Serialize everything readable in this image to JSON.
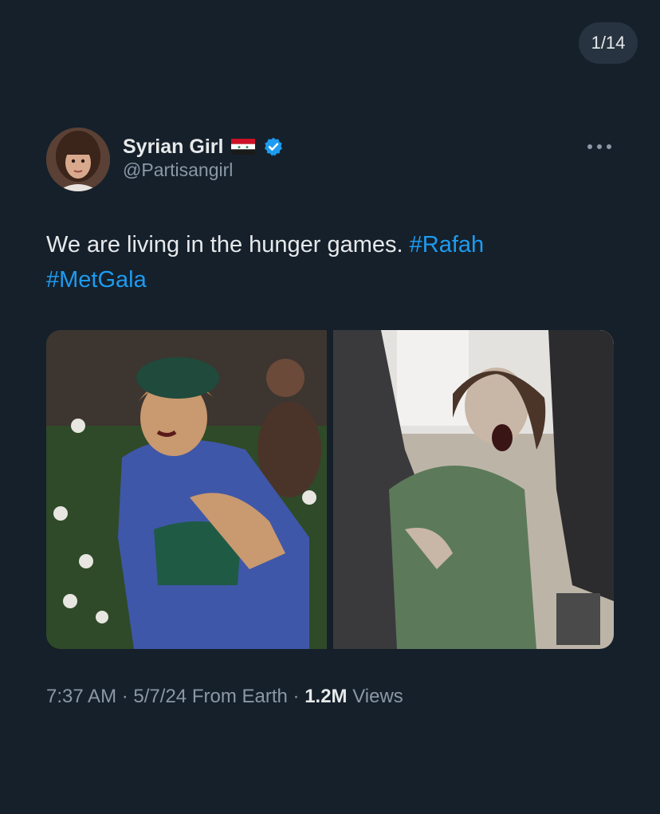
{
  "pager": {
    "counter": "1/14"
  },
  "tweet": {
    "author": {
      "display_name": "Syrian Girl",
      "handle": "@Partisangirl",
      "flag_icon": "syria-flag-icon",
      "verified_icon": "verified-badge-icon"
    },
    "text": "We are living in the hunger games.",
    "hashtags": [
      "#Rafah",
      "#MetGala"
    ],
    "media": [
      {
        "alt_icon": "photo-met-gala"
      },
      {
        "alt_icon": "photo-crying-child"
      }
    ],
    "time": "7:37 AM",
    "separator": "·",
    "date": "5/7/24",
    "source": "From Earth",
    "views_count": "1.2M",
    "views_label": "Views"
  },
  "colors": {
    "background": "#15202b",
    "text": "#e7e9ea",
    "secondary_text": "#8b98a5",
    "accent": "#1d9bf0"
  }
}
